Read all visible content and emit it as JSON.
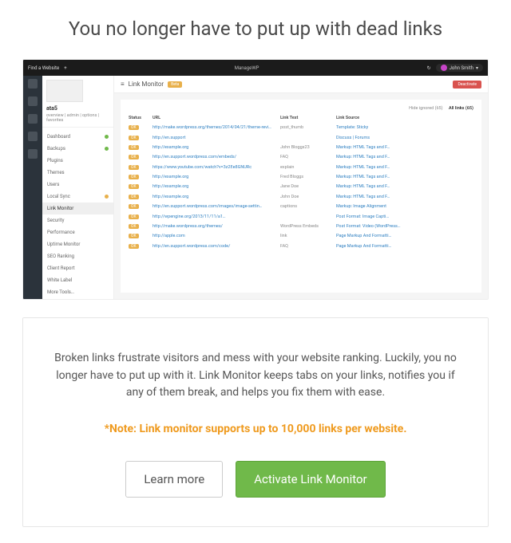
{
  "page": {
    "headline": "You no longer have to put up with dead links",
    "body": "Broken links frustrate visitors and mess with your website ranking. Luckily, you no longer have to put up with it. Link Monitor keeps tabs on your links, notifies you if any of them break, and helps you fix them with ease.",
    "note": "*Note: Link monitor supports up to 10,000 links per website.",
    "learn_more": "Learn more",
    "activate": "Activate Link Monitor"
  },
  "shot": {
    "topbar": {
      "find": "Find a Website",
      "brand": "ManageWP",
      "user": "John Smith"
    },
    "sidebar": {
      "site_name": "ata5",
      "tabs": "overview | admin | options | favorites",
      "items": [
        {
          "label": "Dashboard",
          "dot": "green"
        },
        {
          "label": "Backups",
          "dot": "green"
        },
        {
          "label": "Plugins",
          "dot": ""
        },
        {
          "label": "Themes",
          "dot": ""
        },
        {
          "label": "Users",
          "dot": ""
        },
        {
          "label": "Local Sync",
          "dot": "warn"
        },
        {
          "label": "Link Monitor",
          "dot": "",
          "active": true
        },
        {
          "label": "Security",
          "dot": ""
        },
        {
          "label": "Performance",
          "dot": ""
        },
        {
          "label": "Uptime Monitor",
          "dot": ""
        },
        {
          "label": "SEO Ranking",
          "dot": ""
        },
        {
          "label": "Client Report",
          "dot": ""
        },
        {
          "label": "White Label",
          "dot": ""
        },
        {
          "label": "More Tools…",
          "dot": ""
        }
      ]
    },
    "panel": {
      "title": "Link Monitor",
      "chip": "Beta",
      "deactivate": "Deactivate",
      "filter_inactive": "Hide ignored (65)",
      "filter_active": "All links (65)",
      "headers": {
        "status": "Status",
        "url": "URL",
        "linktext": "Link Text",
        "source": "Link Source"
      },
      "rows": [
        {
          "s": "OK",
          "u": "http://make.wordpress.org/themes/2014/04/21/theme-revi…",
          "t": "post_thumb",
          "src": "Template: Sticky"
        },
        {
          "s": "OK",
          "u": "http://en.support",
          "t": "",
          "src": "Discuss | Forums"
        },
        {
          "s": "OK",
          "u": "http://example.org",
          "t": "John Bloggs23",
          "src": "Markup: HTML Tags and F…"
        },
        {
          "s": "OK",
          "u": "http://en.support.wordpress.com/embeds/",
          "t": "FAQ",
          "src": "Markup: HTML Tags and F…"
        },
        {
          "s": "OK",
          "u": "https://www.youtube.com/watch?v=3z2Ee8GNURc",
          "t": "explain",
          "src": "Markup: HTML Tags and F…"
        },
        {
          "s": "OK",
          "u": "http://example.org",
          "t": "Fred Bloggs",
          "src": "Markup: HTML Tags and F…"
        },
        {
          "s": "OK",
          "u": "http://example.org",
          "t": "Jane Doe",
          "src": "Markup: HTML Tags and F…"
        },
        {
          "s": "OK",
          "u": "http://example.org",
          "t": "John Doe",
          "src": "Markup: HTML Tags and F…"
        },
        {
          "s": "OK",
          "u": "http://en.support.wordpress.com/images/image-settin…",
          "t": "captions",
          "src": "Markup: Image Alignment"
        },
        {
          "s": "OK",
          "u": "http://wpengine.org/2013/11/11/a1…",
          "t": "",
          "src": "Post Format: Image Capti…"
        },
        {
          "s": "OK",
          "u": "http://make.wordpress.org/themes/",
          "t": "WordPress Embeds",
          "src": "Post Format: Video (WordPress…"
        },
        {
          "s": "OK",
          "u": "http://apple.com",
          "t": "link",
          "src": "Page Markup And Formatti…"
        },
        {
          "s": "OK",
          "u": "http://en.support.wordpress.com/code/",
          "t": "FAQ",
          "src": "Page Markup And Formatti…"
        }
      ]
    }
  }
}
